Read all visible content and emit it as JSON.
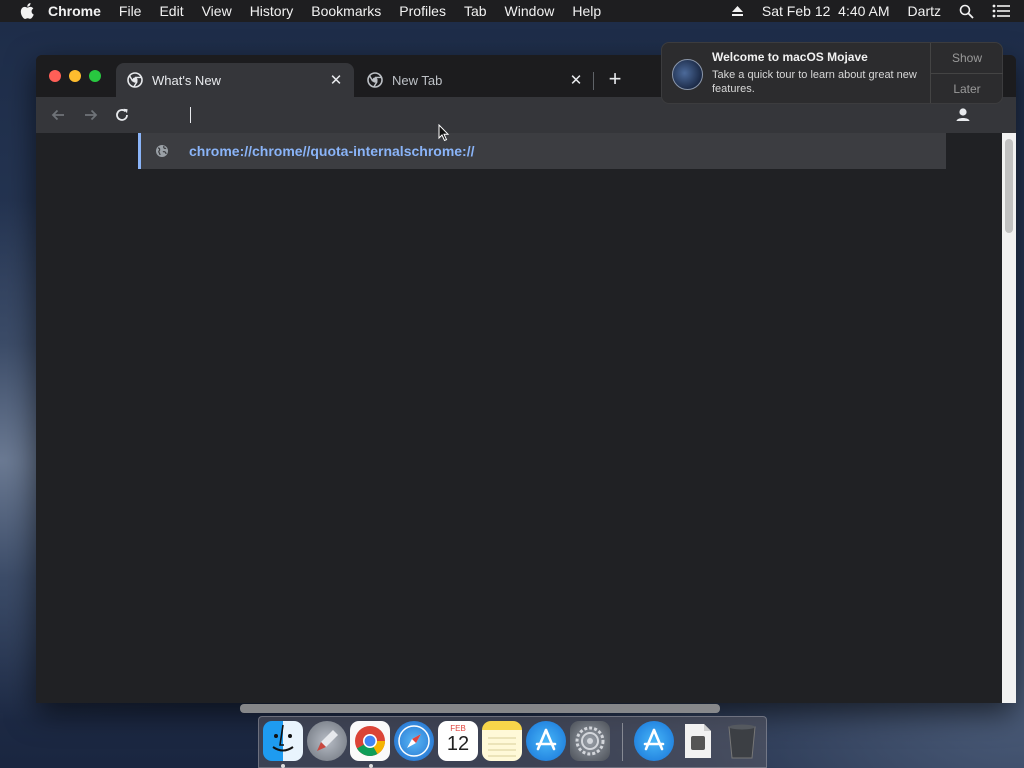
{
  "menubar": {
    "app_name": "Chrome",
    "items": [
      "File",
      "Edit",
      "View",
      "History",
      "Bookmarks",
      "Profiles",
      "Tab",
      "Window",
      "Help"
    ],
    "datetime": "Sat Feb 12  4:40 AM",
    "user": "Dartz"
  },
  "tabs": [
    {
      "title": "What's New",
      "active": true
    },
    {
      "title": "New Tab",
      "active": false
    }
  ],
  "omnibox": {
    "value": "",
    "suggestion": "chrome://chrome//quota-internalschrome://"
  },
  "notification": {
    "title": "Welcome to macOS Mojave",
    "body": "Take a quick tour to learn about great new features.",
    "show_label": "Show",
    "later_label": "Later"
  },
  "dock": {
    "apps": [
      "finder-icon",
      "launchpad-icon",
      "chrome-icon",
      "safari-icon",
      "calendar-icon",
      "notes-icon",
      "app-store-icon",
      "system-preferences-icon",
      "app-store-downloads-icon",
      "preview-file-icon",
      "trash-icon"
    ],
    "calendar_month": "FEB",
    "calendar_day": "12"
  },
  "colors": {
    "accent": "#8ab4f8",
    "window_bg": "#202124",
    "toolbar_bg": "#35363a"
  }
}
